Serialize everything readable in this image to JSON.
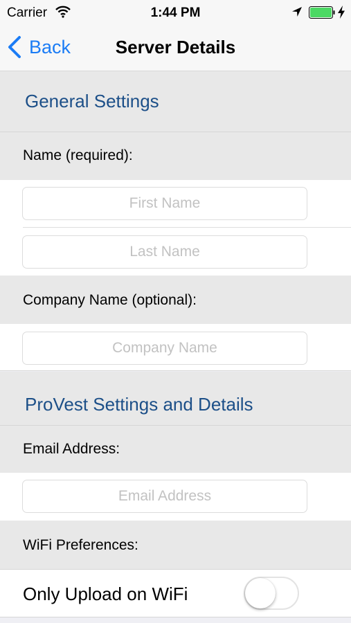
{
  "status_bar": {
    "carrier": "Carrier",
    "time": "1:44 PM",
    "battery_color": "#4cd964"
  },
  "nav": {
    "back_label": "Back",
    "title": "Server Details",
    "accent_color": "#1b7cf5"
  },
  "general_settings": {
    "header": "General Settings",
    "name_label": "Name (required):",
    "first_name": {
      "value": "",
      "placeholder": "First Name"
    },
    "last_name": {
      "value": "",
      "placeholder": "Last Name"
    },
    "company_label": "Company Name (optional):",
    "company_name": {
      "value": "",
      "placeholder": "Company Name"
    }
  },
  "provest_settings": {
    "header": "ProVest Settings and Details",
    "email_label": "Email Address:",
    "email": {
      "value": "",
      "placeholder": "Email Address"
    },
    "wifi_label": "WiFi Preferences:",
    "wifi_toggle_label": "Only Upload on WiFi",
    "wifi_toggle_on": false
  },
  "icons": [
    "wifi-icon",
    "location-arrow-icon",
    "battery-icon",
    "charging-bolt-icon",
    "back-chevron-icon"
  ]
}
